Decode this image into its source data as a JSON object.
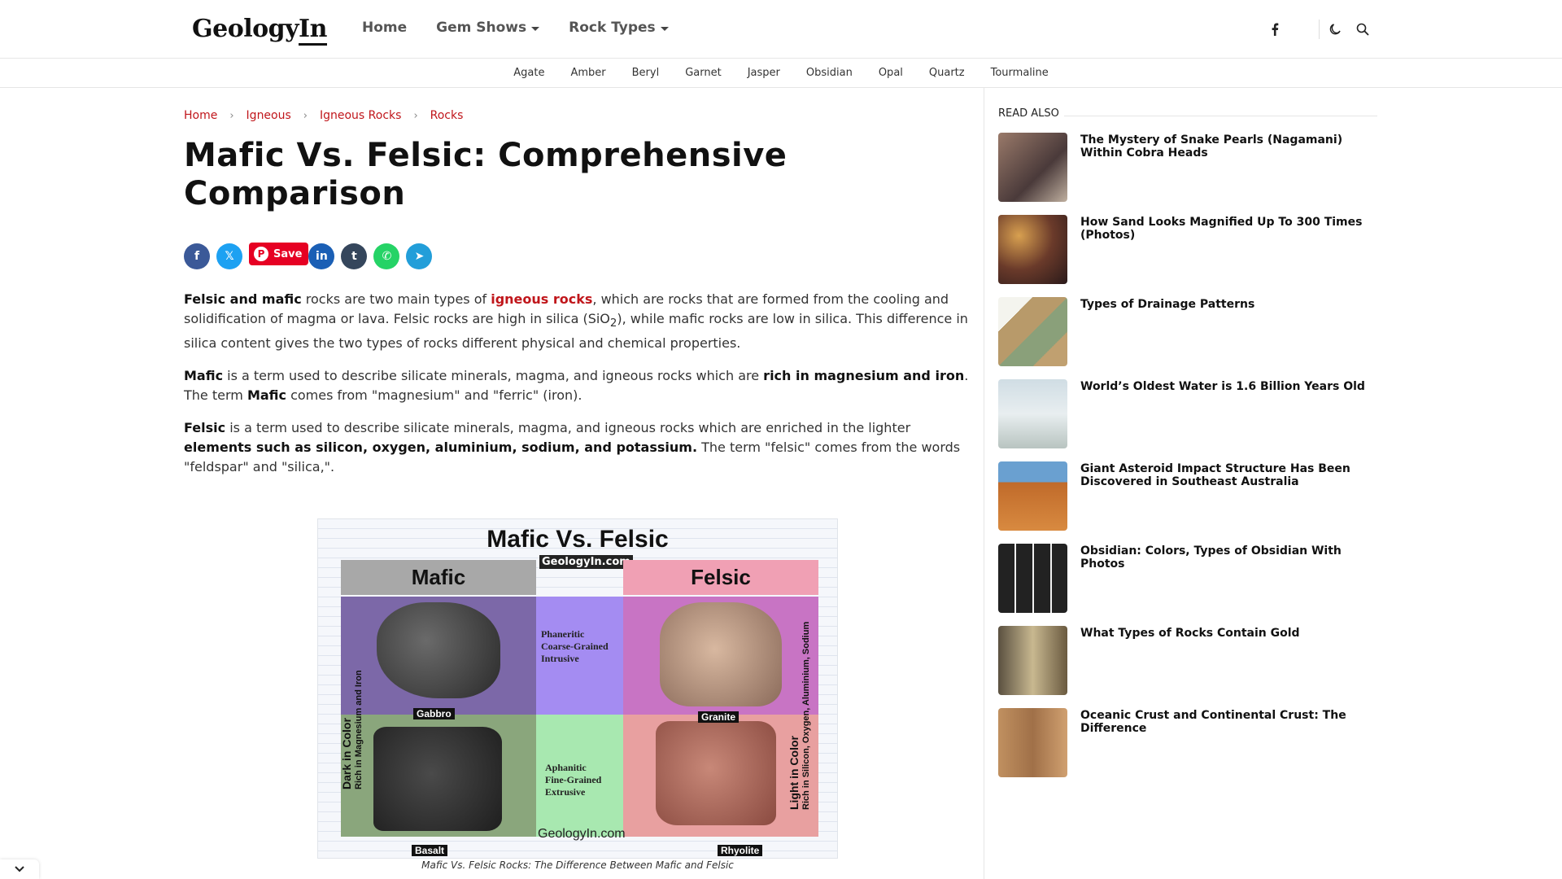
{
  "header": {
    "logo_main": "Geology",
    "logo_suffix": "In",
    "nav": [
      {
        "label": "Home"
      },
      {
        "label": "Gem Shows"
      },
      {
        "label": "Rock Types"
      }
    ],
    "icons": [
      "facebook-icon",
      "moon-icon",
      "search-icon"
    ]
  },
  "subnav": [
    "Agate",
    "Amber",
    "Beryl",
    "Garnet",
    "Jasper",
    "Obsidian",
    "Opal",
    "Quartz",
    "Tourmaline"
  ],
  "breadcrumb": [
    "Home",
    "Igneous",
    "Igneous Rocks",
    "Rocks"
  ],
  "article": {
    "title": "Mafic Vs. Felsic: Comprehensive Comparison",
    "share": {
      "pin_label": "Save",
      "buttons": [
        {
          "name": "facebook",
          "glyph": "f",
          "color": "#3b5998"
        },
        {
          "name": "x-twitter",
          "glyph": "𝕏",
          "color": "#1da1f2"
        },
        {
          "name": "linkedin",
          "glyph": "in",
          "color": "#1b5fb5"
        },
        {
          "name": "tumblr",
          "glyph": "t",
          "color": "#35465c"
        },
        {
          "name": "whatsapp",
          "glyph": "✆",
          "color": "#25d366"
        },
        {
          "name": "telegram",
          "glyph": "➤",
          "color": "#229ed9"
        }
      ]
    },
    "p1": {
      "lead": "Felsic and mafic",
      "t1": " rocks are two main types of ",
      "link": "igneous rocks",
      "t2": ", which are rocks that are formed from the cooling and solidification of magma or lava. Felsic rocks are high in silica (SiO",
      "sub": "2",
      "t3": "), while mafic rocks are low in silica. This difference in silica content gives the two types of rocks different physical and chemical properties."
    },
    "p2": {
      "lead": "Mafic",
      "t1": " is a term used to describe silicate minerals, magma, and igneous rocks which are ",
      "bold": "rich in magnesium and iron",
      "t2": ". The term  ",
      "bold2": "Mafic",
      "t3": " comes from \"magnesium\" and \"ferric\" (iron)."
    },
    "p3": {
      "lead": "Felsic",
      "t1": " is a term used to describe silicate minerals, magma, and igneous rocks which are enriched in the lighter ",
      "bold": "elements such as silicon, oxygen, aluminium, sodium, and potassium.",
      "t2": " The term \"felsic\" comes from the words \"feldspar\" and \"silica,\"."
    },
    "figure": {
      "title": "Mafic Vs. Felsic",
      "site_top": "GeologyIn.com",
      "mafic": "Mafic",
      "felsic": "Felsic",
      "gabbro": "Gabbro",
      "granite": "Granite",
      "basalt": "Basalt",
      "rhyolite": "Rhyolite",
      "intrusive": [
        "Phaneritic",
        "Coarse-Grained",
        "Intrusive"
      ],
      "extrusive": [
        "Aphanitic",
        "Fine-Grained",
        "Extrusive"
      ],
      "left_v1": "Dark in Color",
      "left_v2": "Rich in Magnesium and Iron",
      "right_v1": "Light in Color",
      "right_v2": "Rich in Silicon, Oxygen, Aluminium, Sodium",
      "site_bottom": "GeologyIn.com",
      "caption": "Mafic Vs. Felsic Rocks: The Difference Between Mafic and Felsic"
    }
  },
  "sidebar": {
    "heading": "READ ALSO",
    "posts": [
      {
        "title": "The Mystery of Snake Pearls (Nagamani) Within Cobra Heads",
        "thumb_color": "#7a5a4a"
      },
      {
        "title": "How Sand Looks Magnified Up To 300 Times (Photos)",
        "thumb_color": "#8a5a30"
      },
      {
        "title": "Types of Drainage Patterns",
        "thumb_color": "#b89a6a"
      },
      {
        "title": "World’s Oldest Water is 1.6 Billion Years Old",
        "thumb_color": "#b9cfd8"
      },
      {
        "title": "Giant Asteroid Impact Structure Has Been Discovered in Southeast Australia",
        "thumb_color": "#c06a2a"
      },
      {
        "title": "Obsidian: Colors, Types of Obsidian With Photos",
        "thumb_color": "#333a44"
      },
      {
        "title": "What Types of Rocks Contain Gold",
        "thumb_color": "#8a7a5a"
      },
      {
        "title": "Oceanic Crust and Continental Crust: The Difference",
        "thumb_color": "#b08050"
      }
    ]
  }
}
